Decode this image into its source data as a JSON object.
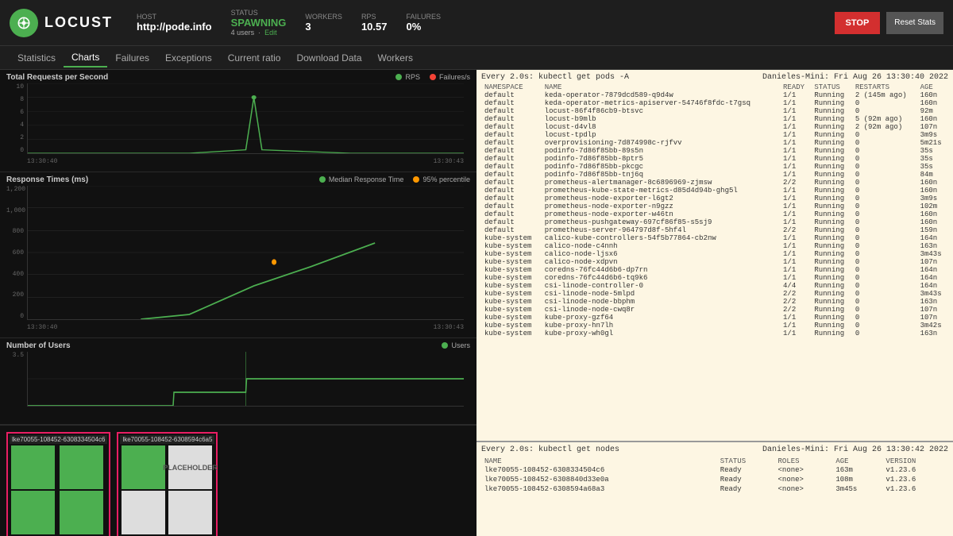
{
  "header": {
    "logo_text": "LOCUST",
    "host_label": "HOST",
    "host_value": "http://pode.info",
    "status_label": "STATUS",
    "status_value": "SPAWNING",
    "status_sub": "4 users",
    "status_edit": "Edit",
    "workers_label": "WORKERS",
    "workers_value": "3",
    "rps_label": "RPS",
    "rps_value": "10.57",
    "failures_label": "FAILURES",
    "failures_value": "0%",
    "stop_label": "STOP",
    "reset_label": "Reset Stats"
  },
  "nav": {
    "items": [
      "Statistics",
      "Charts",
      "Failures",
      "Exceptions",
      "Current ratio",
      "Download Data",
      "Workers"
    ],
    "active": "Charts"
  },
  "charts": {
    "rps_title": "Total Requests per Second",
    "rps_legend": [
      {
        "label": "RPS",
        "color": "#4CAF50"
      },
      {
        "label": "Failures/s",
        "color": "#f44336"
      }
    ],
    "rps_y_labels": [
      "10",
      "8",
      "6",
      "4",
      "2",
      "0"
    ],
    "rps_x_labels": [
      "13:30:40",
      "13:30:43"
    ],
    "response_title": "Response Times (ms)",
    "response_legend": [
      {
        "label": "Median Response Time",
        "color": "#4CAF50"
      },
      {
        "label": "95% percentile",
        "color": "#ff9800"
      }
    ],
    "response_y_labels": [
      "1,200",
      "1,000",
      "800",
      "600",
      "400",
      "200",
      "0"
    ],
    "response_x_labels": [
      "13:30:40",
      "13:30:43"
    ],
    "users_title": "Number of Users",
    "users_legend": [
      {
        "label": "Users",
        "color": "#4CAF50"
      }
    ],
    "users_y_labels": [
      "3.5",
      ""
    ],
    "users_x_labels": []
  },
  "nodes": {
    "cards": [
      {
        "label": "lke70055-108452-6308334504c6",
        "cells": [
          "green",
          "green",
          "green",
          "green"
        ]
      },
      {
        "label": "lke70055-108452-6308594c6a5",
        "cells": [
          "green",
          "placeholder",
          "placeholder",
          "placeholder"
        ]
      }
    ],
    "placeholder_text": "PLACEHOLDER"
  },
  "terminal": {
    "pods_command": "Every 2.0s: kubectl get pods -A",
    "pods_host": "Danieles-Mini: Fri Aug 26 13:30:40 2022",
    "pods_columns": [
      "NAMESPACE",
      "NAME",
      "READY",
      "STATUS",
      "RESTARTS",
      "AGE"
    ],
    "pods_rows": [
      [
        "default",
        "keda-operator-7879dcd589-q9d4w",
        "1/1",
        "Running",
        "2 (145m ago)",
        "160n"
      ],
      [
        "default",
        "keda-operator-metrics-apiserver-54746f8fdc-t7gsq",
        "1/1",
        "Running",
        "0",
        "160n"
      ],
      [
        "default",
        "locust-86f4f86cb9-btsvc",
        "1/1",
        "Running",
        "0",
        "92m"
      ],
      [
        "default",
        "locust-b9mlb",
        "1/1",
        "Running",
        "5 (92m ago)",
        "160n"
      ],
      [
        "default",
        "locust-d4vl8",
        "1/1",
        "Running",
        "2 (92m ago)",
        "107n"
      ],
      [
        "default",
        "locust-tpdlp",
        "1/1",
        "Running",
        "0",
        "3m9s"
      ],
      [
        "default",
        "overprovisioning-7d874998c-rjfvv",
        "1/1",
        "Running",
        "0",
        "5m21s"
      ],
      [
        "default",
        "podinfo-7d86f85bb-89s5n",
        "1/1",
        "Running",
        "0",
        "35s"
      ],
      [
        "default",
        "podinfo-7d86f85bb-8ptr5",
        "1/1",
        "Running",
        "0",
        "35s"
      ],
      [
        "default",
        "podinfo-7d86f85bb-pkcgc",
        "1/1",
        "Running",
        "0",
        "35s"
      ],
      [
        "default",
        "podinfo-7d86f85bb-tnj6q",
        "1/1",
        "Running",
        "0",
        "84m"
      ],
      [
        "default",
        "prometheus-alertmanager-8c6896969-zjmsw",
        "2/2",
        "Running",
        "0",
        "160n"
      ],
      [
        "default",
        "prometheus-kube-state-metrics-d85d4d94b-ghg5l",
        "1/1",
        "Running",
        "0",
        "160n"
      ],
      [
        "default",
        "prometheus-node-exporter-l6gt2",
        "1/1",
        "Running",
        "0",
        "3m9s"
      ],
      [
        "default",
        "prometheus-node-exporter-n9gzz",
        "1/1",
        "Running",
        "0",
        "102m"
      ],
      [
        "default",
        "prometheus-node-exporter-w46tn",
        "1/1",
        "Running",
        "0",
        "160n"
      ],
      [
        "default",
        "prometheus-pushgateway-697cf86f85-s5sj9",
        "1/1",
        "Running",
        "0",
        "160n"
      ],
      [
        "default",
        "prometheus-server-964797d8f-5hf4l",
        "2/2",
        "Running",
        "0",
        "159n"
      ],
      [
        "kube-system",
        "calico-kube-controllers-54f5b77864-cb2nw",
        "1/1",
        "Running",
        "0",
        "164n"
      ],
      [
        "kube-system",
        "calico-node-c4nnh",
        "1/1",
        "Running",
        "0",
        "163n"
      ],
      [
        "kube-system",
        "calico-node-ljsx6",
        "1/1",
        "Running",
        "0",
        "3m43s"
      ],
      [
        "kube-system",
        "calico-node-xdpvn",
        "1/1",
        "Running",
        "0",
        "107n"
      ],
      [
        "kube-system",
        "coredns-76fc44d6b6-dp7rn",
        "1/1",
        "Running",
        "0",
        "164n"
      ],
      [
        "kube-system",
        "coredns-76fc44d6b6-tq9k6",
        "1/1",
        "Running",
        "0",
        "164n"
      ],
      [
        "kube-system",
        "csi-linode-controller-0",
        "4/4",
        "Running",
        "0",
        "164n"
      ],
      [
        "kube-system",
        "csi-linode-node-5mlpd",
        "2/2",
        "Running",
        "0",
        "3m43s"
      ],
      [
        "kube-system",
        "csi-linode-node-bbphm",
        "2/2",
        "Running",
        "0",
        "163n"
      ],
      [
        "kube-system",
        "csi-linode-node-cwq8r",
        "2/2",
        "Running",
        "0",
        "107n"
      ],
      [
        "kube-system",
        "kube-proxy-gzf64",
        "1/1",
        "Running",
        "0",
        "107n"
      ],
      [
        "kube-system",
        "kube-proxy-hn7lh",
        "1/1",
        "Running",
        "0",
        "3m42s"
      ],
      [
        "kube-system",
        "kube-proxy-wh0gl",
        "1/1",
        "Running",
        "0",
        "163n"
      ]
    ],
    "nodes_command": "Every 2.0s: kubectl get nodes",
    "nodes_host": "Danieles-Mini: Fri Aug 26 13:30:42 2022",
    "nodes_columns": [
      "NAME",
      "STATUS",
      "ROLES",
      "AGE",
      "VERSION"
    ],
    "nodes_rows": [
      [
        "lke70055-108452-6308334504c6",
        "Ready",
        "<none>",
        "163m",
        "v1.23.6"
      ],
      [
        "lke70055-108452-6308840d33e0a",
        "Ready",
        "<none>",
        "108m",
        "v1.23.6"
      ],
      [
        "lke70055-108452-6308594a68a3",
        "Ready",
        "<none>",
        "3m45s",
        "v1.23.6"
      ]
    ]
  }
}
